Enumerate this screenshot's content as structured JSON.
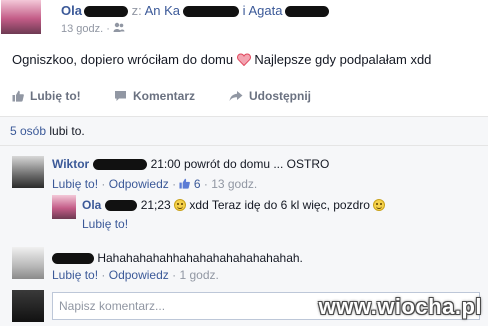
{
  "post": {
    "author": "Ola",
    "with_prefix": "z:",
    "with_name_1": "An Ka",
    "with_name_2_suffix": "i Agata",
    "time": "13 godz.",
    "privacy_icon": "friends-icon",
    "text": "Ogniszkoo, dopiero wróciłam do domu",
    "heart_icon": "heart-icon",
    "text_after": "Najlepsze gdy podpalałam xdd"
  },
  "actions": {
    "like": "Lubię to!",
    "comment": "Komentarz",
    "share": "Udostępnij"
  },
  "likes_summary": {
    "count_link": "5 osób",
    "suffix": "lubi to."
  },
  "comments": [
    {
      "author": "Wiktor",
      "text": "21:00 powrót do domu ... OSTRO",
      "like": "Lubię to!",
      "reply": "Odpowiedz",
      "likes": "6",
      "time": "13 godz."
    },
    {
      "author": "Ola",
      "text_before": "21;23",
      "text_middle": "xdd Teraz idę do 6 kl więc, pozdro",
      "like": "Lubię to!"
    },
    {
      "text": "Hahahahahahhahahahahahahahahah.",
      "like": "Lubię to!",
      "reply": "Odpowiedz",
      "time": "1 godz."
    }
  ],
  "composer": {
    "placeholder": "Napisz komentarz..."
  },
  "watermark": "www.wiocha.pl",
  "colors": {
    "link": "#3b5998",
    "muted": "#9197a3",
    "panel": "#f6f7f9",
    "heart": "#e04a5f"
  }
}
